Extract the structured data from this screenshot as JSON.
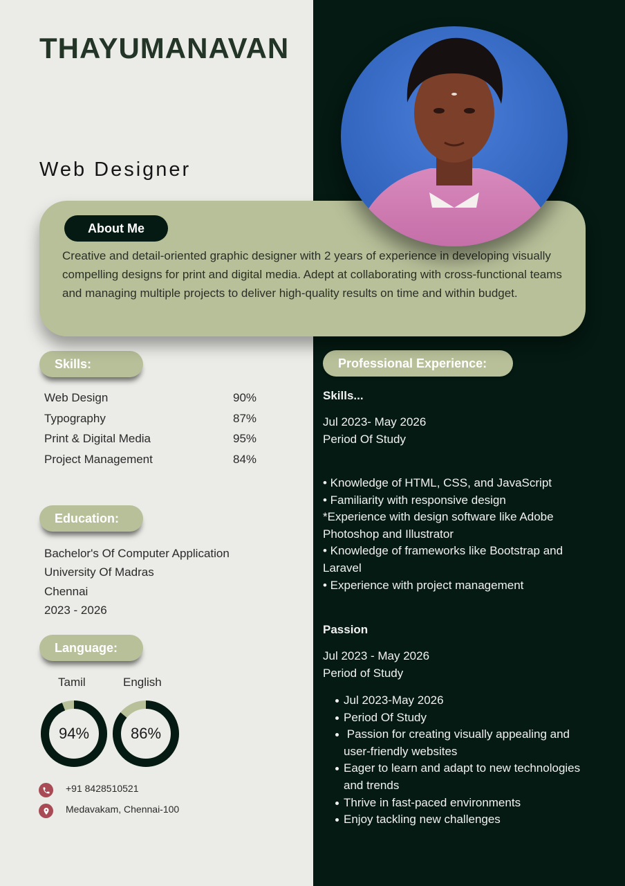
{
  "header": {
    "name": "THAYUMANAVAN",
    "role": "Web Designer"
  },
  "about": {
    "heading": "About Me",
    "text": "Creative and detail-oriented graphic designer with 2 years of experience in developing visually compelling designs for print and digital media. Adept at collaborating with cross-functional teams and managing multiple projects to deliver high-quality results on time and within budget."
  },
  "skills": {
    "heading": "Skills:",
    "items": [
      {
        "name": "Web Design",
        "percent": "90%"
      },
      {
        "name": "Typography",
        "percent": "87%"
      },
      {
        "name": "Print & Digital Media",
        "percent": "95%"
      },
      {
        "name": "Project Management",
        "percent": "84%"
      }
    ]
  },
  "education": {
    "heading": "Education:",
    "lines": [
      "Bachelor's Of Computer Application",
      "University Of Madras",
      "Chennai",
      "2023 - 2026"
    ]
  },
  "language": {
    "heading": "Language:",
    "items": [
      {
        "name": "Tamil",
        "label": "94%",
        "value": 0.94
      },
      {
        "name": "English",
        "label": "86%",
        "value": 0.86
      }
    ]
  },
  "contact": {
    "phone": "+91 8428510521",
    "address": "Medavakam, Chennai-100"
  },
  "experience": {
    "heading": "Professional Experience:",
    "section1": {
      "title": "Skills...",
      "date": "Jul 2023- May 2026",
      "subtitle": "Period Of Study",
      "bullets": [
        "• Knowledge of HTML, CSS, and JavaScript",
        "• Familiarity with responsive design",
        "*Experience with design software like Adobe Photoshop and Illustrator",
        "• Knowledge of frameworks like Bootstrap and Laravel",
        "• Experience with project management"
      ]
    },
    "section2": {
      "title": "Passion",
      "date": "Jul 2023 - May 2026",
      "subtitle": "Period of Study",
      "bullets": [
        "Jul 2023-May 2026",
        "Period Of Study",
        " Passion for creating visually appealing and user-friendly websites",
        "Eager to learn and adapt to new technologies and trends",
        "Thrive in fast-paced environments",
        "Enjoy tackling new challenges"
      ]
    }
  },
  "colors": {
    "dark_panel": "#041a12",
    "sage": "#b8c09a",
    "background": "#ebebe7",
    "icon_accent": "#a84b55"
  }
}
